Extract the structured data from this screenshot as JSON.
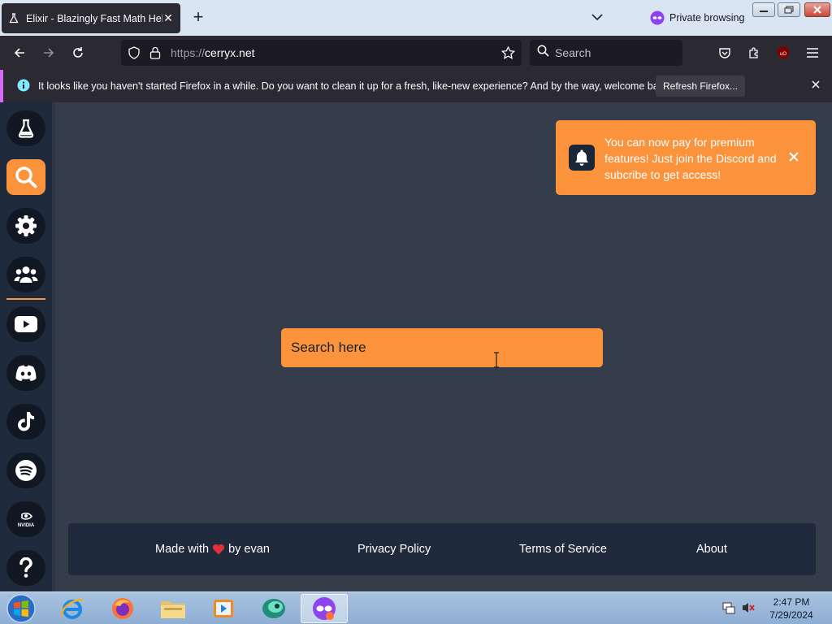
{
  "browser": {
    "tab": {
      "title": "Elixir - Blazingly Fast Math Help!",
      "favicon": "flask-icon",
      "close": "✕"
    },
    "new_tab": "+",
    "private_label": "Private browsing",
    "url": {
      "protocol": "https://",
      "host": "cerryx.net"
    },
    "search_placeholder": "Search"
  },
  "notification": {
    "text": "It looks like you haven't started Firefox in a while. Do you want to clean it up for a fresh, like-new experience? And by the way, welcome back!",
    "button": "Refresh Firefox..."
  },
  "sidebar": {
    "items": [
      {
        "name": "flask",
        "active": false
      },
      {
        "name": "search",
        "active": true
      },
      {
        "name": "settings",
        "active": false
      },
      {
        "name": "users",
        "active": false
      },
      {
        "name": "youtube",
        "active": false
      },
      {
        "name": "discord",
        "active": false
      },
      {
        "name": "tiktok",
        "active": false
      },
      {
        "name": "spotify",
        "active": false
      },
      {
        "name": "nvidia",
        "active": false
      },
      {
        "name": "help",
        "active": false
      }
    ],
    "accent": "#fb933c"
  },
  "toast": {
    "message": "You can now pay for premium features! Just join the Discord and subcribe to get access!"
  },
  "search": {
    "placeholder": "Search here"
  },
  "footer": {
    "made_with_prefix": "Made with",
    "made_with_suffix": "by evan",
    "privacy": "Privacy Policy",
    "terms": "Terms of Service",
    "about": "About"
  },
  "taskbar": {
    "apps": [
      "internet-explorer",
      "firefox",
      "file-explorer",
      "media-player",
      "app-teal",
      "firefox-private"
    ],
    "time": "2:47 PM",
    "date": "7/29/2024"
  }
}
